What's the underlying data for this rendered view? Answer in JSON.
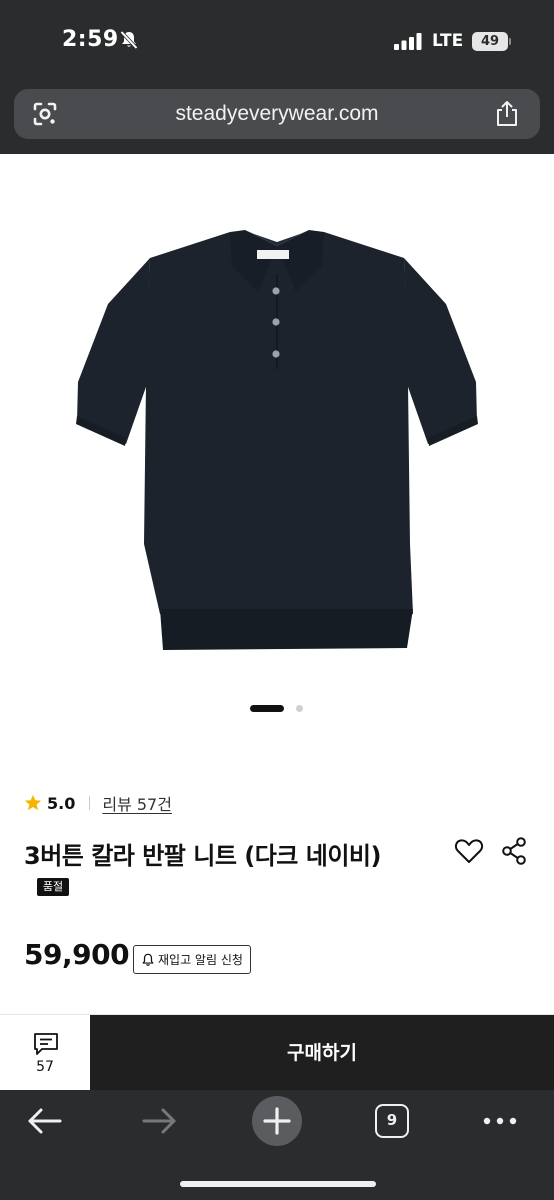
{
  "status_bar": {
    "time": "2:59",
    "network": "LTE",
    "battery": "49"
  },
  "browser": {
    "url": "steadyeverywear.com",
    "open_tabs": "9"
  },
  "product": {
    "rating": "5.0",
    "reviews_label": "리뷰 57건",
    "title": "3버튼 칼라 반팔 니트 (다크 네이비)",
    "badge": "품절",
    "price": "59,900",
    "restock_label": "재입고 알림 신청",
    "carousel": {
      "current": 1,
      "total": 2
    }
  },
  "purchase_bar": {
    "review_count": "57",
    "buy_label": "구매하기"
  },
  "colors": {
    "chrome": "#2b2c2e",
    "url_bar": "#4a4b4e",
    "shirt": "#1c232c",
    "buy_button": "#1f1f1f",
    "star": "#f5b400"
  }
}
